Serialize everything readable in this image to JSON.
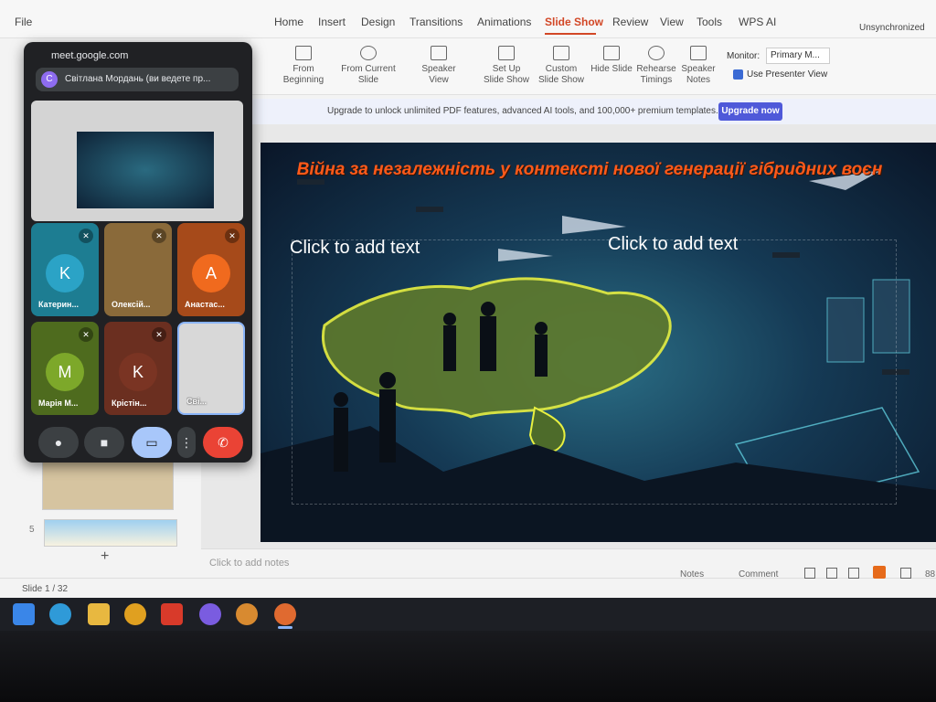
{
  "menubar": {
    "file": "File",
    "items": [
      "Home",
      "Insert",
      "Design",
      "Transitions",
      "Animations",
      "Slide Show",
      "Review",
      "View",
      "Tools"
    ],
    "active": "Slide Show",
    "wps_ai": "WPS AI",
    "sync_status": "Unsynchronized"
  },
  "ribbon": {
    "from_beginning": "From Beginning",
    "from_current": "From Current Slide",
    "speaker_view": "Speaker View",
    "setup_slide_show": "Set Up Slide Show",
    "custom_slide_show": "Custom Slide Show",
    "hide_slide": "Hide Slide",
    "rehearse_timings": "Rehearse Timings",
    "speaker_notes": "Speaker Notes",
    "monitor_label": "Monitor:",
    "monitor_value": "Primary M...",
    "use_presenter_view": "Use Presenter View"
  },
  "banner": {
    "text": "Upgrade to unlock unlimited PDF features, advanced AI tools, and 100,000+ premium templates.",
    "button": "Upgrade now"
  },
  "slide": {
    "title": "Війна за незалежність у контексті нової генерації гібридних воєн",
    "placeholder_left": "Click to add text",
    "placeholder_right": "Click to add text"
  },
  "notes": {
    "placeholder": "Click to add notes"
  },
  "statusbar": {
    "slide_count": "Slide 1 / 32",
    "notes_button": "Notes",
    "comment_button": "Comment",
    "zoom": "88"
  },
  "thumbnails": {
    "slide5_number": "5",
    "add_slide": "+"
  },
  "meet": {
    "url": "meet.google.com",
    "presenter_name": "Світлана Мордань (ви ведете пр...",
    "presenter_initial": "С",
    "participants": [
      {
        "name": "Катерин...",
        "initial": "K",
        "color": "#1d7d92",
        "avatar": "#2ba3c6"
      },
      {
        "name": "Олексій...",
        "initial": "",
        "color": "#8a6a3a",
        "avatar": "#8a6a3a"
      },
      {
        "name": "Анастас...",
        "initial": "A",
        "color": "#a64a1a",
        "avatar": "#f06a1e"
      },
      {
        "name": "Марія М...",
        "initial": "M",
        "color": "#4e6b1e",
        "avatar": "#7da82a"
      },
      {
        "name": "Крістін...",
        "initial": "K",
        "color": "#6b2f20",
        "avatar": "#7a3423"
      },
      {
        "name": "Сві...",
        "initial": "",
        "color": "#d8d8d8",
        "avatar": "#d8d8d8"
      }
    ]
  }
}
